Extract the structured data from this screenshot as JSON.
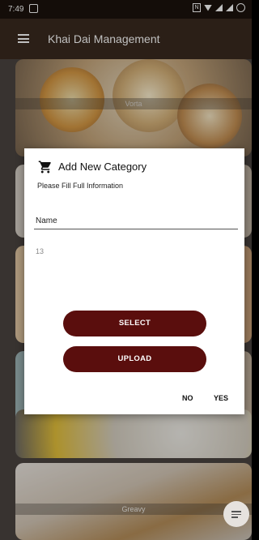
{
  "status_bar": {
    "time": "7:49"
  },
  "app_bar": {
    "title": "Khai Dai Management"
  },
  "cards": [
    {
      "label": "Vorta"
    },
    {
      "label": "Greavy"
    }
  ],
  "dialog": {
    "title": "Add New Category",
    "subtitle": "Please Fill Full Information",
    "name_label": "Name",
    "value_text": "13",
    "select_label": "SELECT",
    "upload_label": "UPLOAD",
    "no_label": "NO",
    "yes_label": "YES"
  },
  "colors": {
    "accent": "#5a0e0d",
    "app_bar": "#3a2a1f"
  },
  "icons": {
    "menu": "hamburger-icon",
    "cart": "cart-icon",
    "fab": "playlist-add-icon"
  }
}
